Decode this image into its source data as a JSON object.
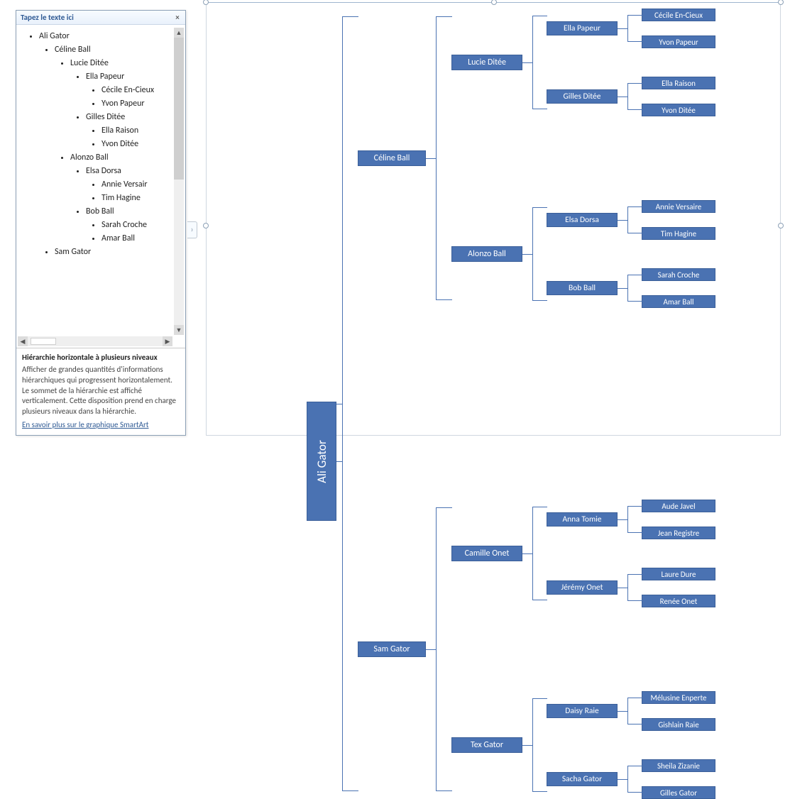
{
  "panel": {
    "title": "Tapez le texte ici",
    "close_glyph": "×",
    "desc_title": "Hiérarchie horizontale à plusieurs niveaux",
    "desc_body": "Afficher de grandes quantités d'informations hiérarchiques qui progressent horizontalement. Le sommet de la hiérarchie est affiché verticalement. Cette disposition prend en charge plusieurs niveaux dans la hiérarchie.",
    "desc_link": "En savoir plus sur le graphique SmartArt"
  },
  "outline": {
    "root": "Ali Gator",
    "children": [
      {
        "name": "Céline Ball",
        "children": [
          {
            "name": "Lucie Ditée",
            "children": [
              {
                "name": "Ella Papeur",
                "children": [
                  {
                    "name": "Cécile En-Cieux"
                  },
                  {
                    "name": "Yvon Papeur"
                  }
                ]
              },
              {
                "name": "Gilles Ditée",
                "children": [
                  {
                    "name": "Ella Raison"
                  },
                  {
                    "name": "Yvon Ditée"
                  }
                ]
              }
            ]
          },
          {
            "name": "Alonzo Ball",
            "children": [
              {
                "name": "Elsa Dorsa",
                "children": [
                  {
                    "name": "Annie Versair"
                  },
                  {
                    "name": "Tim Hagine"
                  }
                ]
              },
              {
                "name": "Bob Ball",
                "children": [
                  {
                    "name": "Sarah Croche"
                  },
                  {
                    "name": "Amar Ball"
                  }
                ]
              }
            ]
          }
        ]
      },
      {
        "name": "Sam Gator"
      }
    ]
  },
  "diagram": {
    "root": "Ali Gator",
    "l1": [
      "Céline Ball",
      "Sam Gator"
    ],
    "l2": [
      "Lucie Ditée",
      "Alonzo Ball",
      "Camille Onet",
      "Tex Gator"
    ],
    "l3": [
      "Ella Papeur",
      "Gilles Ditée",
      "Elsa Dorsa",
      "Bob Ball",
      "Anna Tomie",
      "Jérémy Onet",
      "Daisy Raie",
      "Sacha Gator"
    ],
    "l4": [
      "Cécile En-Cieux",
      "Yvon Papeur",
      "Ella Raison",
      "Yvon Ditée",
      "Annie Versaire",
      "Tim Hagine",
      "Sarah Croche",
      "Amar Ball",
      "Aude Javel",
      "Jean Registre",
      "Laure Dure",
      "Renée Onet",
      "Mélusine Enperte",
      "Gishlain Raie",
      "Sheila Zizanie",
      "Gilles Gator"
    ]
  },
  "glyphs": {
    "expander": "›",
    "up": "▲",
    "down": "▼",
    "left": "◀",
    "right": "▶"
  }
}
